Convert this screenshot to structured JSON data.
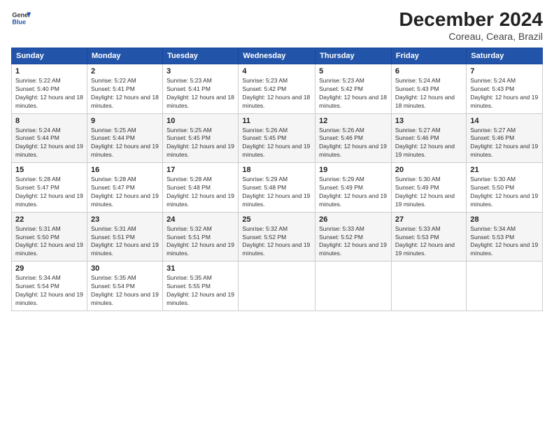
{
  "header": {
    "logo": {
      "general": "General",
      "blue": "Blue"
    },
    "title": "December 2024",
    "location": "Coreau, Ceara, Brazil"
  },
  "weekdays": [
    "Sunday",
    "Monday",
    "Tuesday",
    "Wednesday",
    "Thursday",
    "Friday",
    "Saturday"
  ],
  "weeks": [
    [
      {
        "day": 1,
        "sunrise": "5:22 AM",
        "sunset": "5:40 PM",
        "daylight": "12 hours and 18 minutes."
      },
      {
        "day": 2,
        "sunrise": "5:22 AM",
        "sunset": "5:41 PM",
        "daylight": "12 hours and 18 minutes."
      },
      {
        "day": 3,
        "sunrise": "5:23 AM",
        "sunset": "5:41 PM",
        "daylight": "12 hours and 18 minutes."
      },
      {
        "day": 4,
        "sunrise": "5:23 AM",
        "sunset": "5:42 PM",
        "daylight": "12 hours and 18 minutes."
      },
      {
        "day": 5,
        "sunrise": "5:23 AM",
        "sunset": "5:42 PM",
        "daylight": "12 hours and 18 minutes."
      },
      {
        "day": 6,
        "sunrise": "5:24 AM",
        "sunset": "5:43 PM",
        "daylight": "12 hours and 18 minutes."
      },
      {
        "day": 7,
        "sunrise": "5:24 AM",
        "sunset": "5:43 PM",
        "daylight": "12 hours and 19 minutes."
      }
    ],
    [
      {
        "day": 8,
        "sunrise": "5:24 AM",
        "sunset": "5:44 PM",
        "daylight": "12 hours and 19 minutes."
      },
      {
        "day": 9,
        "sunrise": "5:25 AM",
        "sunset": "5:44 PM",
        "daylight": "12 hours and 19 minutes."
      },
      {
        "day": 10,
        "sunrise": "5:25 AM",
        "sunset": "5:45 PM",
        "daylight": "12 hours and 19 minutes."
      },
      {
        "day": 11,
        "sunrise": "5:26 AM",
        "sunset": "5:45 PM",
        "daylight": "12 hours and 19 minutes."
      },
      {
        "day": 12,
        "sunrise": "5:26 AM",
        "sunset": "5:46 PM",
        "daylight": "12 hours and 19 minutes."
      },
      {
        "day": 13,
        "sunrise": "5:27 AM",
        "sunset": "5:46 PM",
        "daylight": "12 hours and 19 minutes."
      },
      {
        "day": 14,
        "sunrise": "5:27 AM",
        "sunset": "5:46 PM",
        "daylight": "12 hours and 19 minutes."
      }
    ],
    [
      {
        "day": 15,
        "sunrise": "5:28 AM",
        "sunset": "5:47 PM",
        "daylight": "12 hours and 19 minutes."
      },
      {
        "day": 16,
        "sunrise": "5:28 AM",
        "sunset": "5:47 PM",
        "daylight": "12 hours and 19 minutes."
      },
      {
        "day": 17,
        "sunrise": "5:28 AM",
        "sunset": "5:48 PM",
        "daylight": "12 hours and 19 minutes."
      },
      {
        "day": 18,
        "sunrise": "5:29 AM",
        "sunset": "5:48 PM",
        "daylight": "12 hours and 19 minutes."
      },
      {
        "day": 19,
        "sunrise": "5:29 AM",
        "sunset": "5:49 PM",
        "daylight": "12 hours and 19 minutes."
      },
      {
        "day": 20,
        "sunrise": "5:30 AM",
        "sunset": "5:49 PM",
        "daylight": "12 hours and 19 minutes."
      },
      {
        "day": 21,
        "sunrise": "5:30 AM",
        "sunset": "5:50 PM",
        "daylight": "12 hours and 19 minutes."
      }
    ],
    [
      {
        "day": 22,
        "sunrise": "5:31 AM",
        "sunset": "5:50 PM",
        "daylight": "12 hours and 19 minutes."
      },
      {
        "day": 23,
        "sunrise": "5:31 AM",
        "sunset": "5:51 PM",
        "daylight": "12 hours and 19 minutes."
      },
      {
        "day": 24,
        "sunrise": "5:32 AM",
        "sunset": "5:51 PM",
        "daylight": "12 hours and 19 minutes."
      },
      {
        "day": 25,
        "sunrise": "5:32 AM",
        "sunset": "5:52 PM",
        "daylight": "12 hours and 19 minutes."
      },
      {
        "day": 26,
        "sunrise": "5:33 AM",
        "sunset": "5:52 PM",
        "daylight": "12 hours and 19 minutes."
      },
      {
        "day": 27,
        "sunrise": "5:33 AM",
        "sunset": "5:53 PM",
        "daylight": "12 hours and 19 minutes."
      },
      {
        "day": 28,
        "sunrise": "5:34 AM",
        "sunset": "5:53 PM",
        "daylight": "12 hours and 19 minutes."
      }
    ],
    [
      {
        "day": 29,
        "sunrise": "5:34 AM",
        "sunset": "5:54 PM",
        "daylight": "12 hours and 19 minutes."
      },
      {
        "day": 30,
        "sunrise": "5:35 AM",
        "sunset": "5:54 PM",
        "daylight": "12 hours and 19 minutes."
      },
      {
        "day": 31,
        "sunrise": "5:35 AM",
        "sunset": "5:55 PM",
        "daylight": "12 hours and 19 minutes."
      },
      null,
      null,
      null,
      null
    ]
  ]
}
